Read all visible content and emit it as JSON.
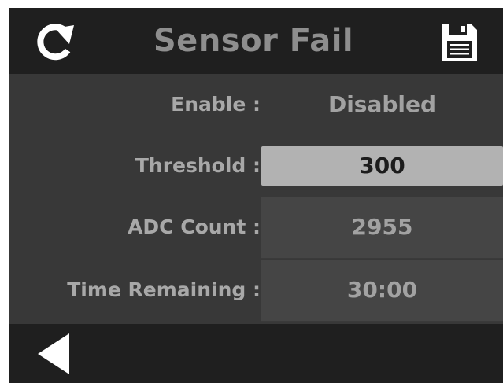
{
  "header": {
    "title": "Sensor Fail",
    "refresh_icon": "refresh-icon",
    "save_icon": "save-icon"
  },
  "rows": [
    {
      "label": "Enable :",
      "value": "Disabled"
    },
    {
      "label": "Threshold :",
      "value": "300"
    },
    {
      "label": "ADC Count :",
      "value": "2955"
    },
    {
      "label": "Time Remaining :",
      "value": "30:00"
    }
  ],
  "footer": {
    "back_icon": "back-arrow-icon"
  },
  "colors": {
    "bar_background": "#1f1f1f",
    "panel_background": "#383838",
    "text_light": "#a8a8a8",
    "input_background": "#b2b2b2",
    "input_text": "#1c1c1c"
  }
}
